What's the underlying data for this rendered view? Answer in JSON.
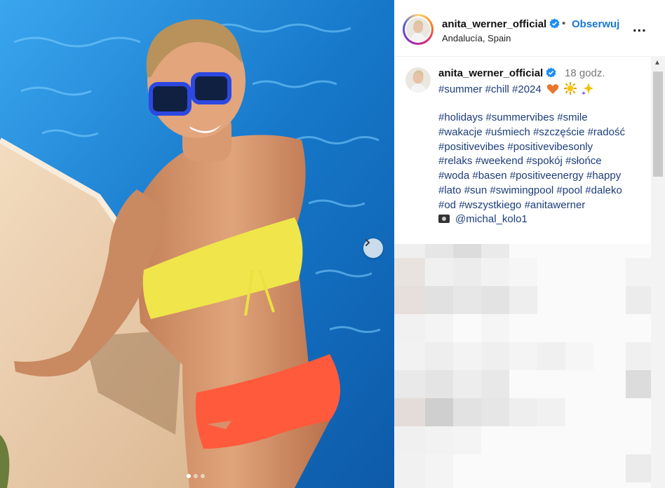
{
  "post": {
    "username": "anita_werner_official",
    "follow_label": "Obserwuj",
    "separator": "•",
    "location": "Andalucía, Spain",
    "more_label": "..."
  },
  "caption": {
    "username": "anita_werner_official",
    "time_ago": "18 godz.",
    "first_line": "#summer #chill #2024",
    "emojis": [
      "heart-icon",
      "sun-icon",
      "sparkles-icon"
    ],
    "hashtag_lines": [
      "#holidays #summervibes #smile",
      "#wakacje #uśmiech #szczęście #radość",
      "#positivevibes #positivevibesonly",
      "#relaks #weekend #spokój #słońce",
      "#woda #basen #positiveenergy #happy",
      "#lato #sun #swimingpool #pool #daleko",
      "#od #wszystkiego #anitawerner"
    ],
    "credit": "@michal_kolo1"
  },
  "carousel": {
    "dots": 3,
    "active_dot": 1
  },
  "colors": {
    "link": "#1877d2",
    "hashtag": "#1c3d7a",
    "verified": "#1f8ef1"
  }
}
